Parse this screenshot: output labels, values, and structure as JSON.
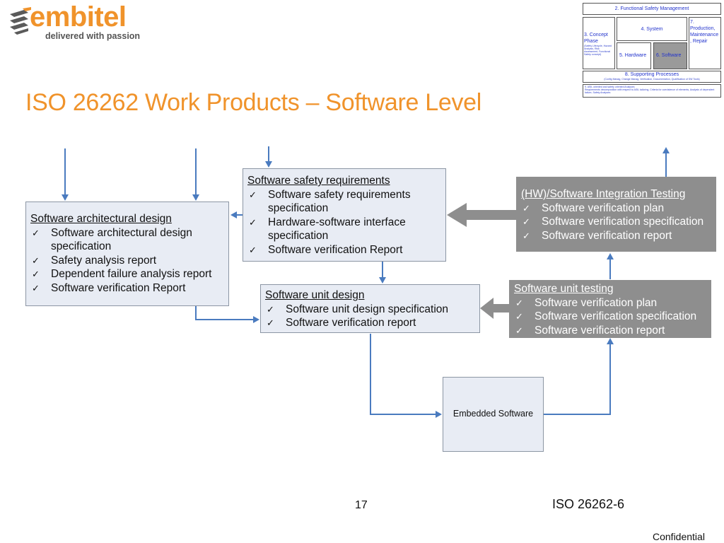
{
  "logo": {
    "brand": "embitel",
    "tagline": "delivered with passion",
    "brand_color": "#f0932b"
  },
  "overview": {
    "functional_safety_management": "2. Functional Safety Management",
    "concept_phase": "3. Concept Phase",
    "concept_phase_detail": "(Safety Lifecycle, Hazard Analysis, Risk Assessment, Functional Safety concept)",
    "system": "4. System",
    "hardware": "5. Hardware",
    "software": "6. Software",
    "production": "7. Production, Maintenance , Repair",
    "supporting_processes": "8. Supporting Processes",
    "supporting_processes_detail": "(Config Manag, Change Manag, Verification, Documentation, Qualification of SW Tools)",
    "asil_note_line1": "9. ASIL oriented and safety oriented Analyses",
    "asil_note_line2": "Requirements decomposition with respect to ASIL tailoring, Criteria for coexistence of elements, Analysis of dependent failure, Safety Analyses",
    "selected_color": "#9a9a9a"
  },
  "title": "ISO 26262 Work Products – Software Level",
  "diagram": {
    "arch_design": {
      "header": "Software architectural design",
      "items": [
        "Software architectural design specification",
        "Safety analysis report",
        "Dependent failure analysis report",
        "Software verification Report"
      ]
    },
    "safety_requirements": {
      "header": "Software safety requirements",
      "items": [
        "Software safety requirements specification",
        "Hardware-software interface specification",
        "Software verification Report"
      ]
    },
    "integration_testing": {
      "header": "(HW)/Software Integration Testing",
      "items": [
        "Software verification plan",
        "Software verification specification",
        "Software verification report"
      ]
    },
    "unit_design": {
      "header": "Software unit design",
      "items": [
        "Software unit design specification",
        "Software verification report"
      ]
    },
    "unit_testing": {
      "header": "Software unit testing",
      "items": [
        "Software verification plan",
        "Software verification specification",
        "Software verification report"
      ]
    },
    "embedded_software": "Embedded Software",
    "check_glyph": "✓",
    "colors": {
      "box_fill": "#e8ecf4",
      "box_border": "#8c96a4",
      "grey_box_fill": "#8e8e8e",
      "connector_blue": "#4a7bbf",
      "feedback_arrow_grey": "#8e8e8e"
    }
  },
  "footer": {
    "page_number": "17",
    "standard_reference": "ISO 26262-6",
    "confidential": "Confidential"
  }
}
